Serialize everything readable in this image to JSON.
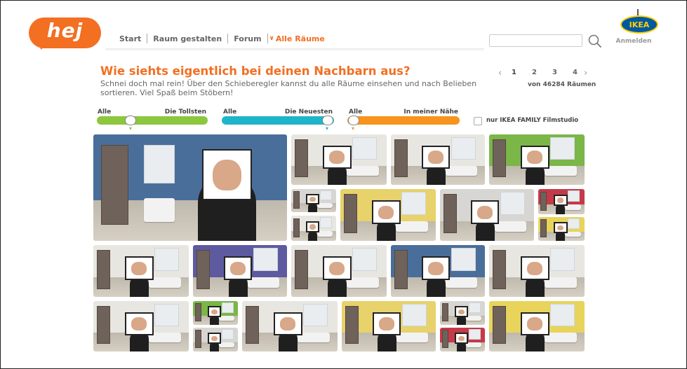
{
  "header": {
    "logo_text": "hej",
    "nav": {
      "start": "Start",
      "raum": "Raum gestalten",
      "forum": "Forum",
      "alle": "Alle Räume"
    },
    "search_placeholder": "",
    "ikea": "IKEA",
    "login": "Anmelden"
  },
  "intro": {
    "headline": "Wie siehts eigentlich bei deinen Nachbarn aus?",
    "subline": "Schnei doch mal rein! Über den Schieberegler kannst du alle Räume einsehen und nach Belieben sortieren. Viel Spaß beim Stöbern!"
  },
  "pager": {
    "prev": "‹",
    "next": "›",
    "pages": [
      "1",
      "2",
      "3",
      "4"
    ],
    "current": "1",
    "count_text": "von 46284 Räumen"
  },
  "filters": {
    "slider1": {
      "left": "Alle",
      "right": "Die Tollsten",
      "color": "#8dc63f"
    },
    "slider2": {
      "left": "Alle",
      "right": "Die Neuesten",
      "color": "#1fb5c9"
    },
    "slider3": {
      "left": "Alle",
      "right": "In meiner Nähe",
      "color": "#f7941d"
    },
    "checkbox_label": "nur IKEA FAMILY Filmstudio",
    "checkbox_checked": false
  },
  "colors": {
    "accent": "#f36f22",
    "ikea_blue": "#0058a3",
    "ikea_yellow": "#ffd100"
  },
  "gallery": {
    "tile_count": 26,
    "wall_colors": [
      "#4a6e9a",
      "#e8e6e1",
      "#e8e6e1",
      "#7ab648",
      "#d8d6d2",
      "#e8e6e1",
      "#e7d26b",
      "#d8d6d2",
      "#c43a49",
      "#e8d45a",
      "#e8e6e1",
      "#5d5aa0",
      "#e8e6e1"
    ]
  }
}
